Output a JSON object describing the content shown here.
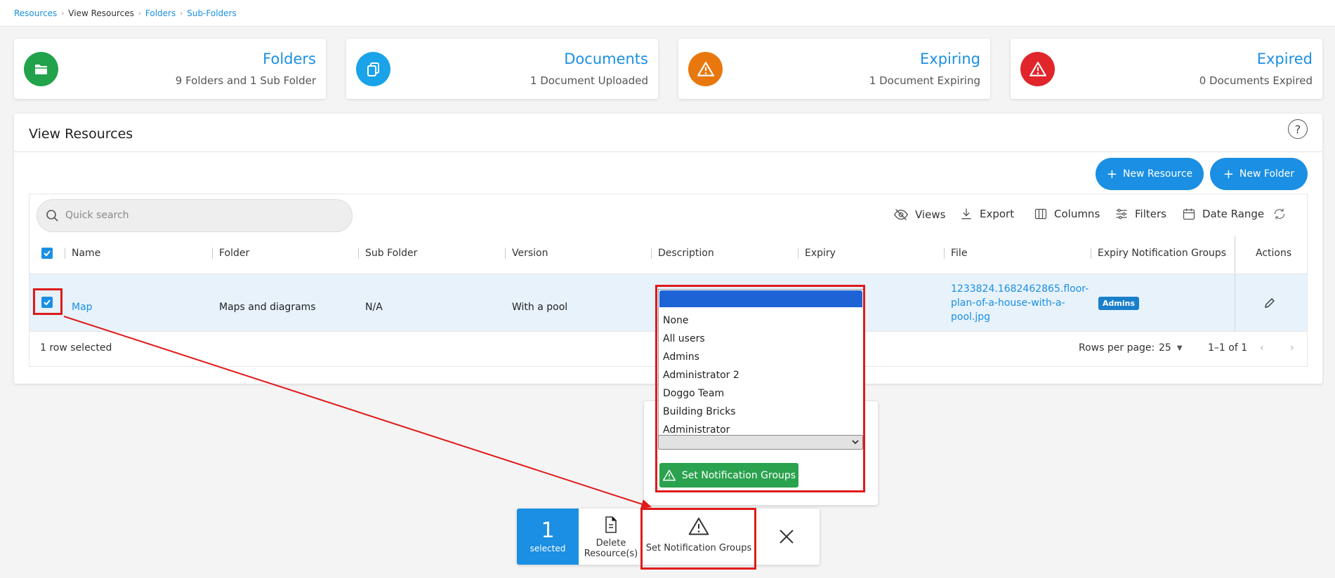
{
  "breadcrumb": {
    "items": [
      "Resources",
      "View Resources",
      "Folders",
      "Sub-Folders"
    ]
  },
  "cards": {
    "folders": {
      "title": "Folders",
      "subtitle": "9 Folders and 1 Sub Folder",
      "color": "#22a24a"
    },
    "documents": {
      "title": "Documents",
      "subtitle": "1 Document Uploaded",
      "color": "#1aa3e8"
    },
    "expiring": {
      "title": "Expiring",
      "subtitle": "1 Document Expiring",
      "color": "#e8780e"
    },
    "expired": {
      "title": "Expired",
      "subtitle": "0 Documents Expired",
      "color": "#e0262b"
    }
  },
  "panel": {
    "title": "View Resources",
    "help": "?"
  },
  "buttons": {
    "new_resource": "New Resource",
    "new_folder": "New Folder"
  },
  "search": {
    "placeholder": "Quick search"
  },
  "toolbar": {
    "views": "Views",
    "export": "Export",
    "columns": "Columns",
    "filters": "Filters",
    "date_range": "Date Range"
  },
  "table": {
    "headers": [
      "Name",
      "Folder",
      "Sub Folder",
      "Version",
      "Description",
      "Expiry",
      "File",
      "Expiry Notification Groups",
      "Actions"
    ],
    "row": {
      "name": "Map",
      "folder": "Maps and diagrams",
      "sub_folder": "N/A",
      "version": "With a pool",
      "file": "1233824.1682462865.floor-plan-of-a-house-with-a-pool.jpg",
      "badge": "Admins"
    }
  },
  "footer": {
    "selected": "1 row selected",
    "rows_per_page_label": "Rows per page:",
    "rows_per_page": "25",
    "range": "1–1 of 1"
  },
  "dropdown": {
    "options": [
      "None",
      "All users",
      "Admins",
      "Administrator 2",
      "Doggo Team",
      "Building Bricks",
      "Administrator"
    ],
    "set_button": "Set Notification Groups"
  },
  "action_bar": {
    "count": "1",
    "count_label": "selected",
    "delete": "Delete Resource(s)",
    "set_groups": "Set Notification Groups"
  },
  "colors": {
    "accent": "#1a8fe3",
    "highlight": "#e01a1a",
    "green": "#2aa24e"
  }
}
